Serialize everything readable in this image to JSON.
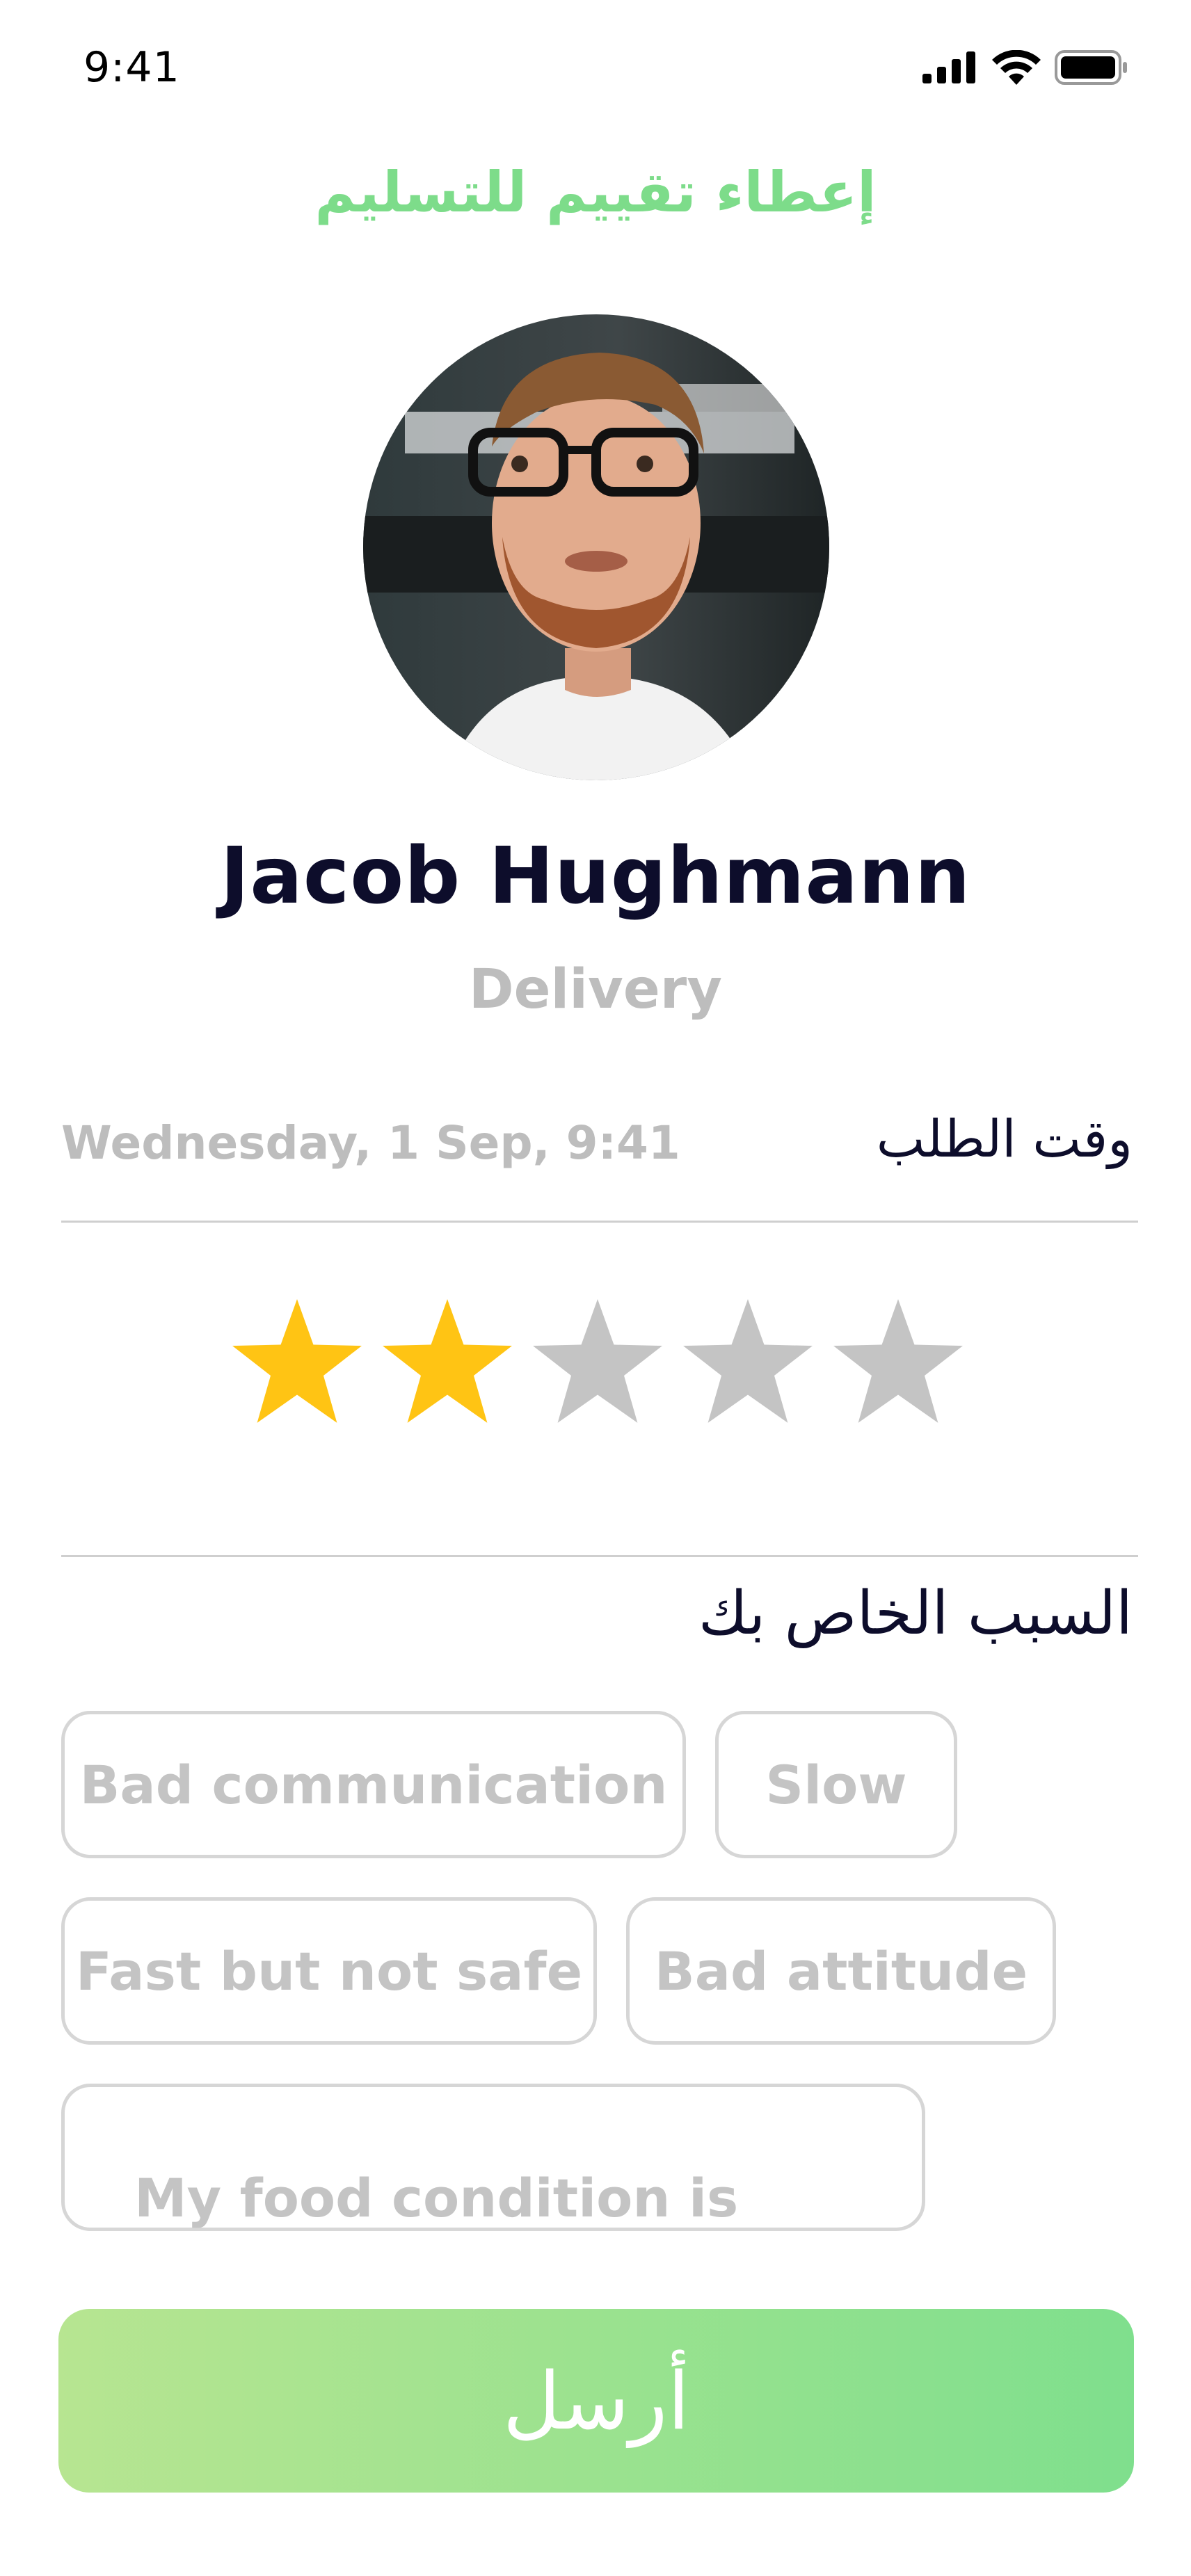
{
  "status_bar": {
    "time": "9:41"
  },
  "header": {
    "title": "إعطاء تقييم للتسليم"
  },
  "driver": {
    "name": "Jacob Hughmann",
    "role": "Delivery"
  },
  "order": {
    "time_label": "وقت الطلب",
    "date": "Wednesday, 1 Sep, 9:41"
  },
  "rating": {
    "value": 2,
    "max": 5,
    "active_color": "#FFC414",
    "inactive_color": "#C4C4C4"
  },
  "reasons": {
    "label": "السبب الخاص بك",
    "chips": [
      "Bad communication",
      "Slow",
      "Fast but not safe",
      "Bad attitude",
      "My food condition is ruined"
    ]
  },
  "submit": {
    "label": "أرسل"
  },
  "colors": {
    "accent_green": "#7DDC8A",
    "gradient_start": "#B7E591",
    "gradient_end": "#7FDF8D"
  }
}
